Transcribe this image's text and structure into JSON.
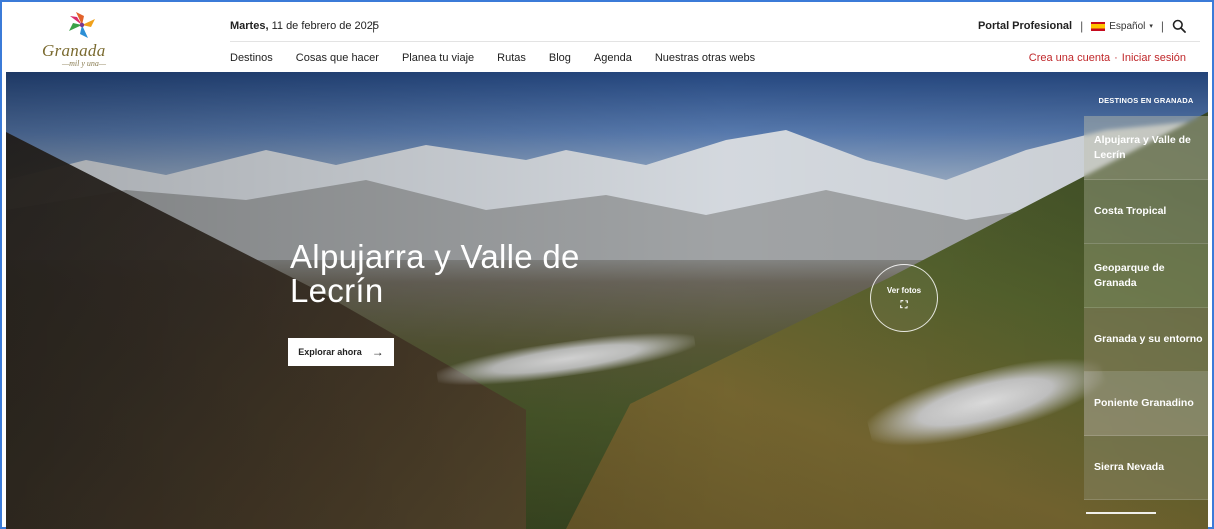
{
  "brand": {
    "name": "Granada",
    "tagline": "—mil y una—"
  },
  "header": {
    "date_day": "Martes,",
    "date_rest": " 11 de febrero de 2025",
    "date_sep": "|",
    "portal": "Portal Profesional",
    "sep": "|",
    "language": "Español",
    "language_caret": "▾",
    "search_icon": "search-icon"
  },
  "nav": {
    "items": [
      "Destinos",
      "Cosas que hacer",
      "Planea tu viaje",
      "Rutas",
      "Blog",
      "Agenda",
      "Nuestras otras webs"
    ]
  },
  "account": {
    "create": "Crea una cuenta",
    "dot": "·",
    "login": "Iniciar sesión"
  },
  "hero": {
    "title": "Alpujarra y Valle de Lecrín",
    "explore_label": "Explorar ahora",
    "explore_arrow": "→",
    "photos_label": "Ver fotos",
    "photos_icon": "⛶"
  },
  "destinations": {
    "heading": "DESTINOS EN GRANADA",
    "items": [
      "Alpujarra y Valle de Lecrín",
      "Costa Tropical",
      "Geoparque de Granada",
      "Granada y su entorno",
      "Poniente Granadino",
      "Sierra Nevada"
    ]
  },
  "colors": {
    "accent_red": "#c0282b",
    "frame_blue": "#3b7bd8"
  }
}
